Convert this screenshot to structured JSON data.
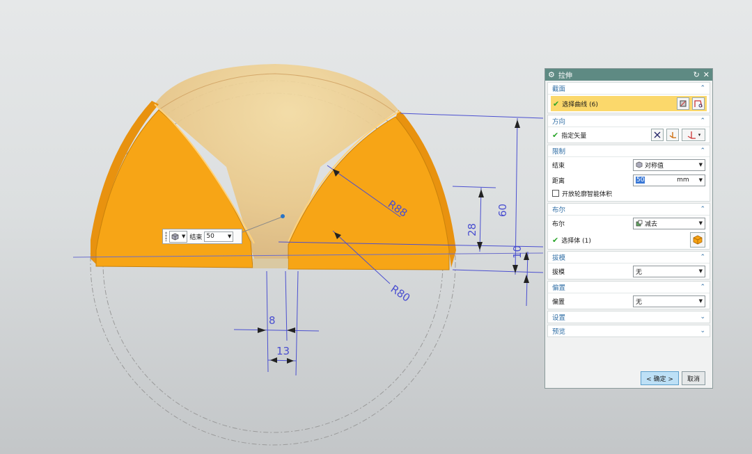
{
  "viewport": {
    "dimensions": {
      "r88": "R88",
      "r80": "R80",
      "d60": "60",
      "d28": "28",
      "d10": "10",
      "d8": "8",
      "d13": "13"
    },
    "colors": {
      "face": "#f6a213",
      "dim": "#4a4fd0",
      "sphere": "#efcf8c"
    }
  },
  "float_input": {
    "icon": "solid-body-icon",
    "label": "结束",
    "value": "50"
  },
  "dialog": {
    "title": "拉伸",
    "section": {
      "title": "截面",
      "select_curve": "选择曲线 (6)"
    },
    "direction": {
      "title": "方向",
      "specify_vector": "指定矢量"
    },
    "limits": {
      "title": "限制",
      "end_label": "结束",
      "end_value": "对称值",
      "distance_label": "距离",
      "distance_value": "50",
      "distance_unit": "mm",
      "open_profile": "开放轮廓智能体积"
    },
    "boolean": {
      "title": "布尔",
      "boolean_label": "布尔",
      "boolean_value": "减去",
      "select_body": "选择体 (1)"
    },
    "draft": {
      "title": "拔模",
      "draft_label": "拔模",
      "draft_value": "无"
    },
    "offset": {
      "title": "偏置",
      "offset_label": "偏置",
      "offset_value": "无"
    },
    "settings": {
      "title": "设置"
    },
    "preview": {
      "title": "预览"
    },
    "ok": "< 确定 >",
    "cancel": "取消"
  }
}
